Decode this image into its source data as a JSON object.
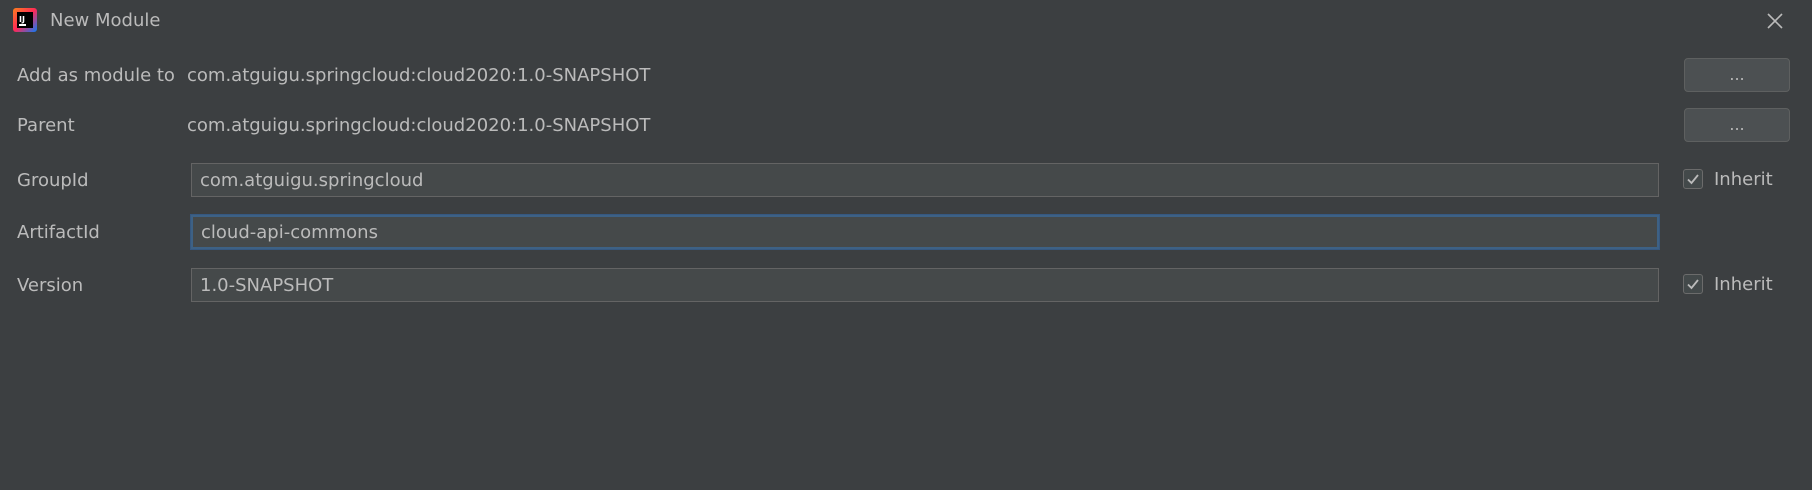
{
  "window": {
    "title": "New Module",
    "icon": "intellij-idea-icon",
    "close_icon": "close-icon"
  },
  "form": {
    "add_as_module_to": {
      "label": "Add as module to",
      "value": "com.atguigu.springcloud:cloud2020:1.0-SNAPSHOT",
      "button_label": "..."
    },
    "parent": {
      "label": "Parent",
      "value": "com.atguigu.springcloud:cloud2020:1.0-SNAPSHOT",
      "button_label": "..."
    },
    "group_id": {
      "label": "GroupId",
      "value": "com.atguigu.springcloud",
      "inherit_label": "Inherit",
      "inherit_checked": true
    },
    "artifact_id": {
      "label": "ArtifactId",
      "value": "cloud-api-commons"
    },
    "version": {
      "label": "Version",
      "value": "1.0-SNAPSHOT",
      "inherit_label": "Inherit",
      "inherit_checked": true
    }
  },
  "colors": {
    "background": "#3c3f41",
    "text": "#bbbbbb",
    "input_background": "#45494a",
    "focus_border": "#3d6185"
  }
}
